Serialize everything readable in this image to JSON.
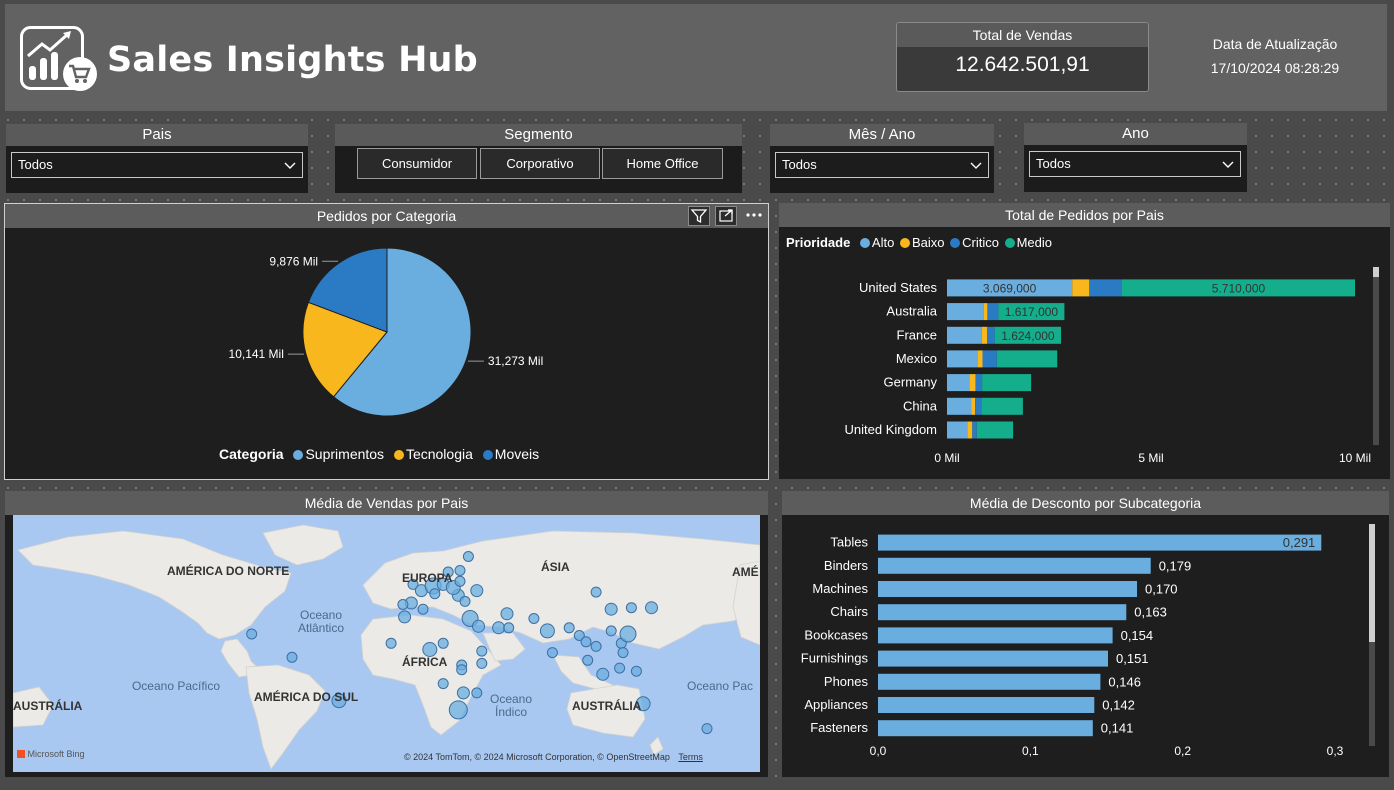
{
  "header": {
    "title": "Sales Insights Hub",
    "kpi_label": "Total de Vendas",
    "kpi_value": "12.642.501,91",
    "update_label": "Data de Atualização",
    "update_value": "17/10/2024 08:28:29"
  },
  "slicers": {
    "pais": {
      "label": "Pais",
      "value": "Todos"
    },
    "segmento": {
      "label": "Segmento",
      "options": [
        "Consumidor",
        "Corporativo",
        "Home Office"
      ]
    },
    "mes_ano": {
      "label": "Mês / Ano",
      "value": "Todos"
    },
    "ano": {
      "label": "Ano",
      "value": "Todos"
    }
  },
  "colors": {
    "light_blue": "#6aaee0",
    "yellow": "#f7b71d",
    "dark_blue": "#2a7ac4",
    "teal": "#14ae8c",
    "panel_bg": "#1e1e1e",
    "header_bg": "#626262"
  },
  "icons": {
    "logo": "sales-chart-cart-icon",
    "header_actions": [
      "filter-icon",
      "focus-mode-icon",
      "more-options-icon"
    ],
    "dropdown": "chevron-down-icon"
  },
  "chart_data": [
    {
      "id": "pie",
      "type": "pie",
      "title": "Pedidos por Categoria",
      "legend_title": "Categoria",
      "legend_position": "bottom",
      "slices": [
        {
          "name": "Suprimentos",
          "value": 31.273,
          "label": "31,273 Mil",
          "color": "#6aaee0"
        },
        {
          "name": "Tecnologia",
          "value": 10.141,
          "label": "10,141 Mil",
          "color": "#f7b71d"
        },
        {
          "name": "Moveis",
          "value": 9.876,
          "label": "9,876 Mil",
          "color": "#2a7ac4"
        }
      ]
    },
    {
      "id": "stacked",
      "type": "bar",
      "orientation": "horizontal",
      "stacked": true,
      "title": "Total de Pedidos por Pais",
      "legend_title": "Prioridade",
      "legend_position": "top-left",
      "categories": [
        "United States",
        "Australia",
        "France",
        "Mexico",
        "Germany",
        "China",
        "United Kingdom"
      ],
      "series": [
        {
          "name": "Alto",
          "color": "#6aaee0",
          "values": [
            3069000,
            900000,
            850000,
            750000,
            550000,
            600000,
            500000
          ],
          "labels": [
            "3.069,000",
            "",
            "",
            "",
            "",
            "",
            ""
          ]
        },
        {
          "name": "Baixo",
          "color": "#f7b71d",
          "values": [
            420000,
            90000,
            130000,
            120000,
            150000,
            90000,
            120000
          ],
          "labels": [
            "",
            "",
            "",
            "",
            "",
            "",
            ""
          ]
        },
        {
          "name": "Critico",
          "color": "#2a7ac4",
          "values": [
            800000,
            270000,
            190000,
            350000,
            160000,
            150000,
            110000
          ],
          "labels": [
            "",
            "",
            "",
            "",
            "",
            "",
            ""
          ]
        },
        {
          "name": "Medio",
          "color": "#14ae8c",
          "values": [
            5710000,
            1617000,
            1624000,
            1480000,
            1200000,
            1020000,
            890000
          ],
          "labels": [
            "5.710,000",
            "1.617,000",
            "1.624,000",
            "",
            "",
            "",
            ""
          ]
        }
      ],
      "x_ticks": [
        {
          "value": 0,
          "label": "0 Mil"
        },
        {
          "value": 5000000,
          "label": "5 Mil"
        },
        {
          "value": 10000000,
          "label": "10 Mil"
        }
      ],
      "xlim": [
        0,
        10000000
      ]
    },
    {
      "id": "map",
      "type": "scatter",
      "title": "Média de Vendas por Pais",
      "labels": {
        "continents": [
          "AMÉRICA DO NORTE",
          "EUROPA",
          "ÁSIA",
          "AMÉ",
          "ÁFRICA",
          "AMÉRICA DO SUL",
          "AUSTRÁLIA",
          "AUSTRÁLIA"
        ],
        "oceans": [
          "Oceano Atlântico",
          "Oceano Pacífico",
          "Oceano Índico",
          "Oceano Pac"
        ]
      },
      "attribution": "© 2024 TomTom, © 2024 Microsoft Corporation, © OpenStreetMap",
      "terms": "Terms",
      "brand": "Microsoft Bing",
      "points": [
        {
          "lon": -99,
          "lat": 20,
          "size": 5
        },
        {
          "lon": -75,
          "lat": 5,
          "size": 5
        },
        {
          "lon": -47,
          "lat": -23,
          "size": 7
        },
        {
          "lon": -3,
          "lat": 52,
          "size": 5
        },
        {
          "lon": 2,
          "lat": 48,
          "size": 6
        },
        {
          "lon": 9,
          "lat": 51,
          "size": 8
        },
        {
          "lon": 10,
          "lat": 46,
          "size": 5
        },
        {
          "lon": 15,
          "lat": 52,
          "size": 6
        },
        {
          "lon": 18,
          "lat": 60,
          "size": 5
        },
        {
          "lon": 25,
          "lat": 61,
          "size": 5
        },
        {
          "lon": 24,
          "lat": 45,
          "size": 6
        },
        {
          "lon": 28,
          "lat": 41,
          "size": 5
        },
        {
          "lon": 21,
          "lat": 50,
          "size": 7
        },
        {
          "lon": -4,
          "lat": 40,
          "size": 6
        },
        {
          "lon": -9,
          "lat": 39,
          "size": 5
        },
        {
          "lon": 25,
          "lat": 54,
          "size": 5
        },
        {
          "lon": 35,
          "lat": 48,
          "size": 6
        },
        {
          "lon": 30,
          "lat": 70,
          "size": 5
        },
        {
          "lon": -16,
          "lat": 14,
          "size": 5
        },
        {
          "lon": -8,
          "lat": 31,
          "size": 6
        },
        {
          "lon": 3,
          "lat": 36,
          "size": 5
        },
        {
          "lon": 31,
          "lat": 30,
          "size": 8
        },
        {
          "lon": 36,
          "lat": 25,
          "size": 6
        },
        {
          "lon": 7,
          "lat": 10,
          "size": 7
        },
        {
          "lon": 15,
          "lat": 14,
          "size": 5
        },
        {
          "lon": 38,
          "lat": 9,
          "size": 5
        },
        {
          "lon": 38,
          "lat": 1,
          "size": 5
        },
        {
          "lon": 26,
          "lat": 0,
          "size": 5
        },
        {
          "lon": 15,
          "lat": -12,
          "size": 5
        },
        {
          "lon": 26,
          "lat": -3,
          "size": 5
        },
        {
          "lon": 27,
          "lat": -18,
          "size": 6
        },
        {
          "lon": 24,
          "lat": -29,
          "size": 9
        },
        {
          "lon": 35,
          "lat": -18,
          "size": 5
        },
        {
          "lon": 48,
          "lat": 24,
          "size": 6
        },
        {
          "lon": 54,
          "lat": 24,
          "size": 5
        },
        {
          "lon": 53,
          "lat": 33,
          "size": 6
        },
        {
          "lon": 69,
          "lat": 30,
          "size": 5
        },
        {
          "lon": 77,
          "lat": 22,
          "size": 7
        },
        {
          "lon": 80,
          "lat": 8,
          "size": 5
        },
        {
          "lon": 90,
          "lat": 24,
          "size": 5
        },
        {
          "lon": 96,
          "lat": 19,
          "size": 5
        },
        {
          "lon": 100,
          "lat": 15,
          "size": 5
        },
        {
          "lon": 106,
          "lat": 12,
          "size": 5
        },
        {
          "lon": 101,
          "lat": 3,
          "size": 5
        },
        {
          "lon": 110,
          "lat": -6,
          "size": 6
        },
        {
          "lon": 121,
          "lat": 14,
          "size": 5
        },
        {
          "lon": 115,
          "lat": 22,
          "size": 5
        },
        {
          "lon": 115,
          "lat": 36,
          "size": 6
        },
        {
          "lon": 139,
          "lat": 37,
          "size": 6
        },
        {
          "lon": 127,
          "lat": 37,
          "size": 5
        },
        {
          "lon": 106,
          "lat": 47,
          "size": 5
        },
        {
          "lon": 125,
          "lat": 20,
          "size": 8
        },
        {
          "lon": 130,
          "lat": -4,
          "size": 5
        },
        {
          "lon": 120,
          "lat": -2,
          "size": 5
        },
        {
          "lon": 134,
          "lat": -25,
          "size": 7
        },
        {
          "lon": 172,
          "lat": -41,
          "size": 5
        },
        {
          "lon": 122,
          "lat": 8,
          "size": 5
        }
      ]
    },
    {
      "id": "discount",
      "type": "bar",
      "orientation": "horizontal",
      "title": "Média de Desconto por Subcategoria",
      "categories": [
        "Tables",
        "Binders",
        "Machines",
        "Chairs",
        "Bookcases",
        "Furnishings",
        "Phones",
        "Appliances",
        "Fasteners"
      ],
      "values": [
        0.291,
        0.179,
        0.17,
        0.163,
        0.154,
        0.151,
        0.146,
        0.142,
        0.141
      ],
      "labels": [
        "0,291",
        "0,179",
        "0,170",
        "0,163",
        "0,154",
        "0,151",
        "0,146",
        "0,142",
        "0,141"
      ],
      "x_ticks": [
        {
          "value": 0,
          "label": "0,0"
        },
        {
          "value": 0.1,
          "label": "0,1"
        },
        {
          "value": 0.2,
          "label": "0,2"
        },
        {
          "value": 0.3,
          "label": "0,3"
        }
      ],
      "xlim": [
        0,
        0.3
      ],
      "color": "#6aaee0"
    }
  ]
}
